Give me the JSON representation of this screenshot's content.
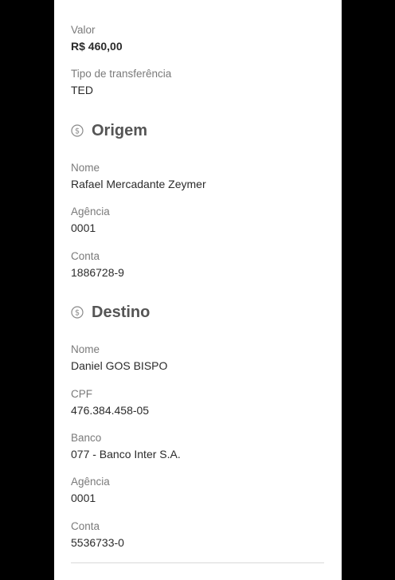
{
  "transfer": {
    "valor_label": "Valor",
    "valor_value": "R$ 460,00",
    "tipo_label": "Tipo de transferência",
    "tipo_value": "TED"
  },
  "origem": {
    "title": "Origem",
    "icon": "dollar-coin-icon",
    "nome_label": "Nome",
    "nome_value": "Rafael Mercadante Zeymer",
    "agencia_label": "Agência",
    "agencia_value": "0001",
    "conta_label": "Conta",
    "conta_value": "1886728-9"
  },
  "destino": {
    "title": "Destino",
    "icon": "dollar-coin-icon",
    "nome_label": "Nome",
    "nome_value": "Daniel GOS BISPO",
    "cpf_label": "CPF",
    "cpf_value": "476.384.458-05",
    "banco_label": "Banco",
    "banco_value": "077 - Banco Inter S.A.",
    "agencia_label": "Agência",
    "agencia_value": "0001",
    "conta_label": "Conta",
    "conta_value": "5536733-0"
  },
  "colors": {
    "background": "#000000",
    "card": "#ffffff",
    "label": "#7a7a7a",
    "value": "#2b2b2b",
    "section_title": "#555555"
  }
}
